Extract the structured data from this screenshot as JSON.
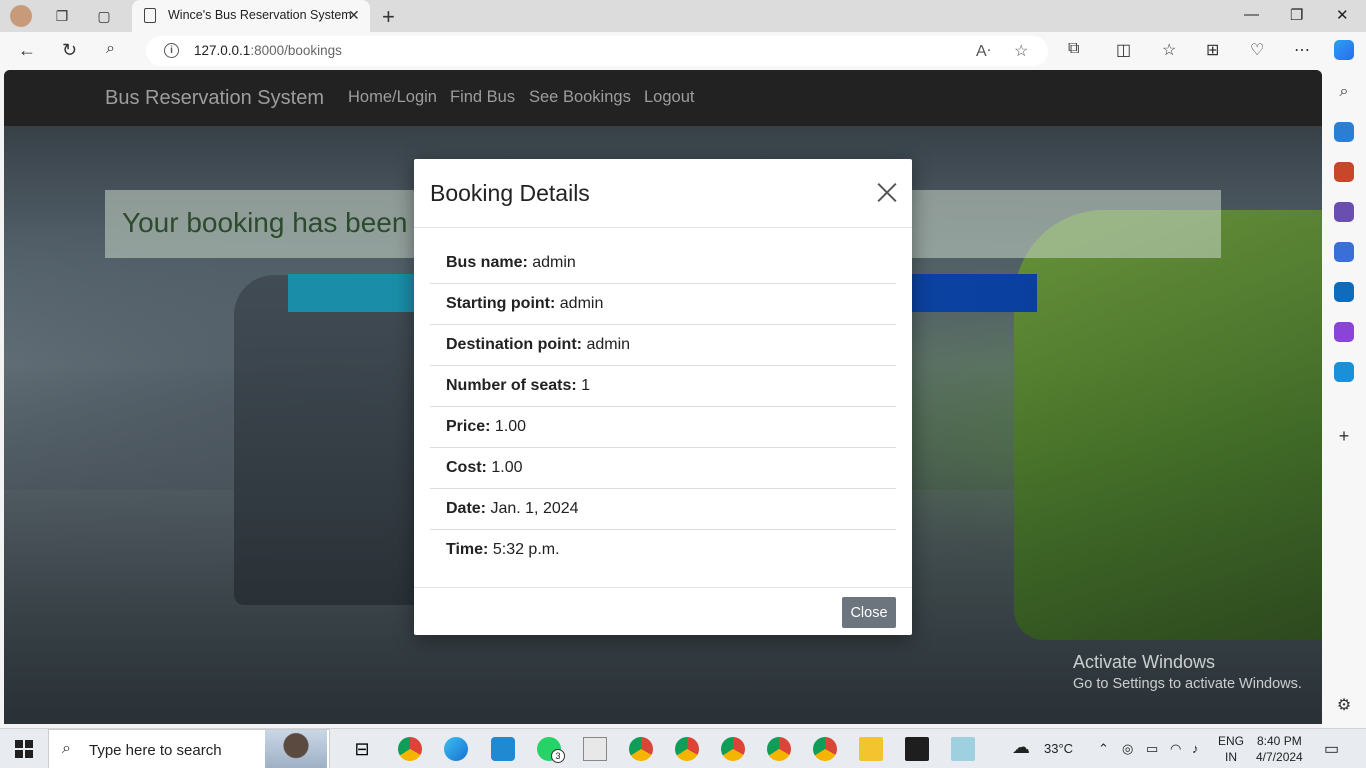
{
  "browser": {
    "tab_title": "Wince's Bus Reservation System",
    "url_host": "127.0.0.1",
    "url_rest": ":8000/bookings"
  },
  "navbar": {
    "brand": "Bus Reservation System",
    "links": [
      "Home/Login",
      "Find Bus",
      "See Bookings",
      "Logout"
    ]
  },
  "page": {
    "alert_text": "Your booking has been"
  },
  "modal": {
    "title": "Booking Details",
    "details": [
      {
        "label": "Bus name:",
        "value": "admin"
      },
      {
        "label": "Starting point:",
        "value": "admin"
      },
      {
        "label": "Destination point:",
        "value": "admin"
      },
      {
        "label": "Number of seats:",
        "value": "1"
      },
      {
        "label": "Price:",
        "value": "1.00"
      },
      {
        "label": "Cost:",
        "value": "1.00"
      },
      {
        "label": "Date:",
        "value": "Jan. 1, 2024"
      },
      {
        "label": "Time:",
        "value": "5:32 p.m."
      }
    ],
    "close_label": "Close"
  },
  "watermark": {
    "line1": "Activate Windows",
    "line2": "Go to Settings to activate Windows."
  },
  "taskbar": {
    "search_placeholder": "Type here to search",
    "whatsapp_badge": "3",
    "temperature": "33°C",
    "lang": "ENG",
    "region": "IN",
    "time": "8:40 PM",
    "date": "4/7/2024"
  },
  "colors": {
    "navbar": "#222222",
    "alert_bg": "#c8d7c8",
    "close_button": "#6c757d",
    "stripe_start": "#1a8ea8",
    "stripe_end": "#0a3fa0"
  }
}
